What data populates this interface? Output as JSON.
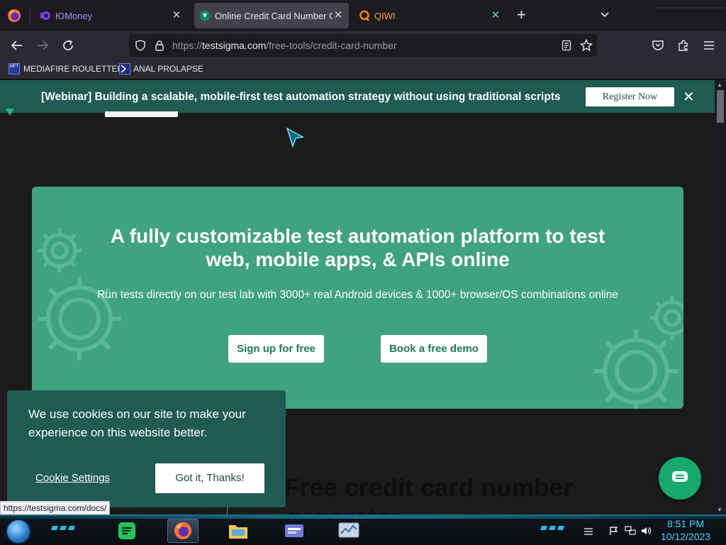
{
  "browser": {
    "tabs": [
      {
        "label": "ЮMoney",
        "active": false
      },
      {
        "label": "Online Credit Card Number Gen",
        "active": true
      },
      {
        "label": "QIWI",
        "active": false
      }
    ],
    "url": {
      "scheme": "https://",
      "host": "testsigma.com",
      "path": "/free-tools/credit-card-number"
    },
    "bookmarks": [
      {
        "label": "MEDIAFIRE ROULETTER",
        "icon_text": "MFT"
      },
      {
        "label": "ANAL PROLAPSE"
      }
    ]
  },
  "page": {
    "webinar": {
      "text": "[Webinar] Building a scalable, mobile-first test automation strategy without using traditional scripts",
      "register_label": "Register Now",
      "close_glyph": "✕"
    },
    "hero": {
      "title": "A fully customizable test automation platform to test web, mobile apps, & APIs online",
      "subtitle": "Run tests directly on our test lab with 3000+ real Android devices & 1000+ browser/OS combinations online",
      "signup_label": "Sign up for free",
      "demo_label": "Book a free demo"
    },
    "cookie": {
      "text": "We use cookies on our site to make your experience on this website better.",
      "settings_label": "Cookie Settings",
      "accept_label": "Got it, Thanks!"
    },
    "section": {
      "title_line1": "Free credit card number",
      "title_line2": "generator"
    },
    "status_url": "https://testsigma.com/docs/"
  },
  "taskbar": {
    "time": "8:51 PM",
    "date": "10/12/2023"
  },
  "colors": {
    "hero_bg": "#3fa380",
    "banner_bg": "#1f5b52",
    "chat_bg": "#17a86b",
    "clock": "#46d7ff"
  }
}
